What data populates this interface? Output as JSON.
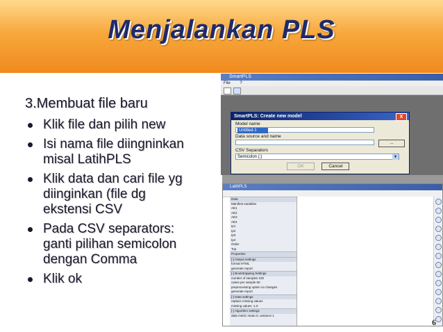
{
  "slide": {
    "title": "Menjalankan PLS",
    "section_heading": "3.Membuat file baru",
    "bullets": [
      "Klik file dan pilih new",
      "Isi nama file diingninkan\nmisal LatihPLS",
      "Klik data dan cari file yg\ndiinginkan (file dg\nekstensi CSV",
      "Pada CSV separators:\nganti pilihan semicolon\ndengan Comma",
      "Klik ok"
    ],
    "page_number": "6"
  },
  "screenshot1": {
    "app_title": "SmartPLS",
    "menu": [
      "File",
      "?"
    ],
    "dialog_title": "SmartPLS: Create new model",
    "close_label": "X",
    "model_name_label": "Model name",
    "model_name_value": "Untitled-1",
    "data_source_label": "Data source and name",
    "browse_label": "...",
    "csv_label": "CSV Separators",
    "csv_value": "Semicolon (;)",
    "ok_label": "OK",
    "cancel_label": "Cancel"
  },
  "screenshot2": {
    "window_title": "LatihPLS",
    "panel_rows": [
      "Data",
      "Manifest variables",
      "AE1",
      "AE2",
      "AE3",
      "AE4",
      "Ip1",
      "Ip2",
      "Ip3",
      "Ip4",
      "Order",
      "Top",
      "Properties",
      "[-] Output settings",
      "format          HTML",
      "generate report",
      "[-] Bootstrapping Settings",
      "number of samples        100",
      "cases per sample           50",
      "preprocessing option    no changes",
      "generate report",
      "[-] Data settings",
      "replace missing values",
      "missing values          -1.0",
      "[-] Algorithm settings",
      "data metric        mean 0, variance 1"
    ]
  }
}
